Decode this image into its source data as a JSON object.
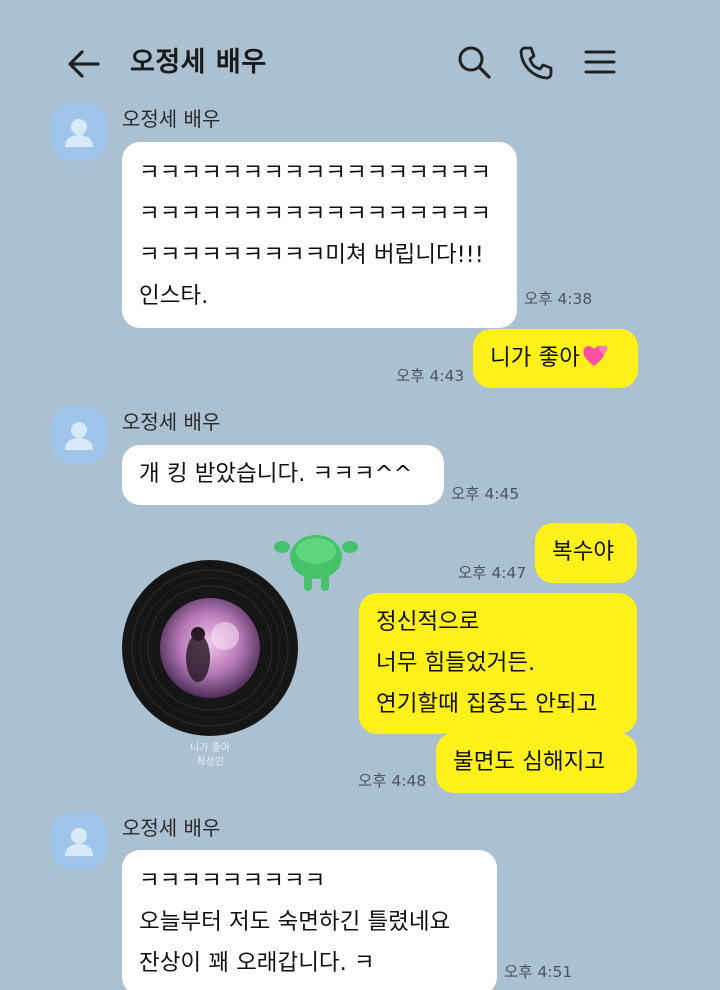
{
  "header": {
    "title": "오정세 배우",
    "back_icon": "back-arrow-icon",
    "search_icon": "search-icon",
    "call_icon": "phone-icon",
    "menu_icon": "hamburger-menu-icon"
  },
  "colors": {
    "background": "#abc1d1",
    "incoming_bubble": "#ffffff",
    "outgoing_bubble": "#fef01b",
    "avatar": "#9fc6ea"
  },
  "messages": [
    {
      "sender": "오정세 배우",
      "lines": [
        "ㅋㅋㅋㅋㅋㅋㅋㅋㅋㅋㅋㅋㅋㅋㅋㅋㅋ",
        "ㅋㅋㅋㅋㅋㅋㅋㅋㅋㅋㅋㅋㅋㅋㅋㅋㅋ",
        "ㅋㅋㅋㅋㅋㅋㅋㅋㅋ미쳐 버립니다!!!",
        "인스타."
      ],
      "time": "오후 4:38"
    },
    {
      "text": "니가 좋아",
      "emoji": "two-hearts-emoji",
      "time": "오후 4:43"
    },
    {
      "sender": "오정세 배우",
      "lines": [
        "개 킹 받았습니다. ㅋㅋㅋ^^"
      ],
      "time": "오후 4:45"
    },
    {
      "text": "복수야",
      "time": "오후 4:47"
    },
    {
      "lines": [
        "정신적으로",
        "너무 힘들었거든.",
        "연기할때 집중도 안되고"
      ]
    },
    {
      "text": "불면도 심해지고",
      "time": "오후 4:48"
    },
    {
      "sender": "오정세 배우",
      "lines": [
        "ㅋㅋㅋㅋㅋㅋㅋㅋㅋ",
        "오늘부터 저도 숙면하긴 틀렸네요",
        "잔상이 꽤 오래갑니다. ㅋ"
      ],
      "time": "오후 4:51"
    }
  ],
  "album": {
    "icon": "vinyl-record-image",
    "caption_title": "니가 좋아",
    "caption_artist": "최성민"
  },
  "emoticon": {
    "icon": "green-character-emoticon"
  }
}
